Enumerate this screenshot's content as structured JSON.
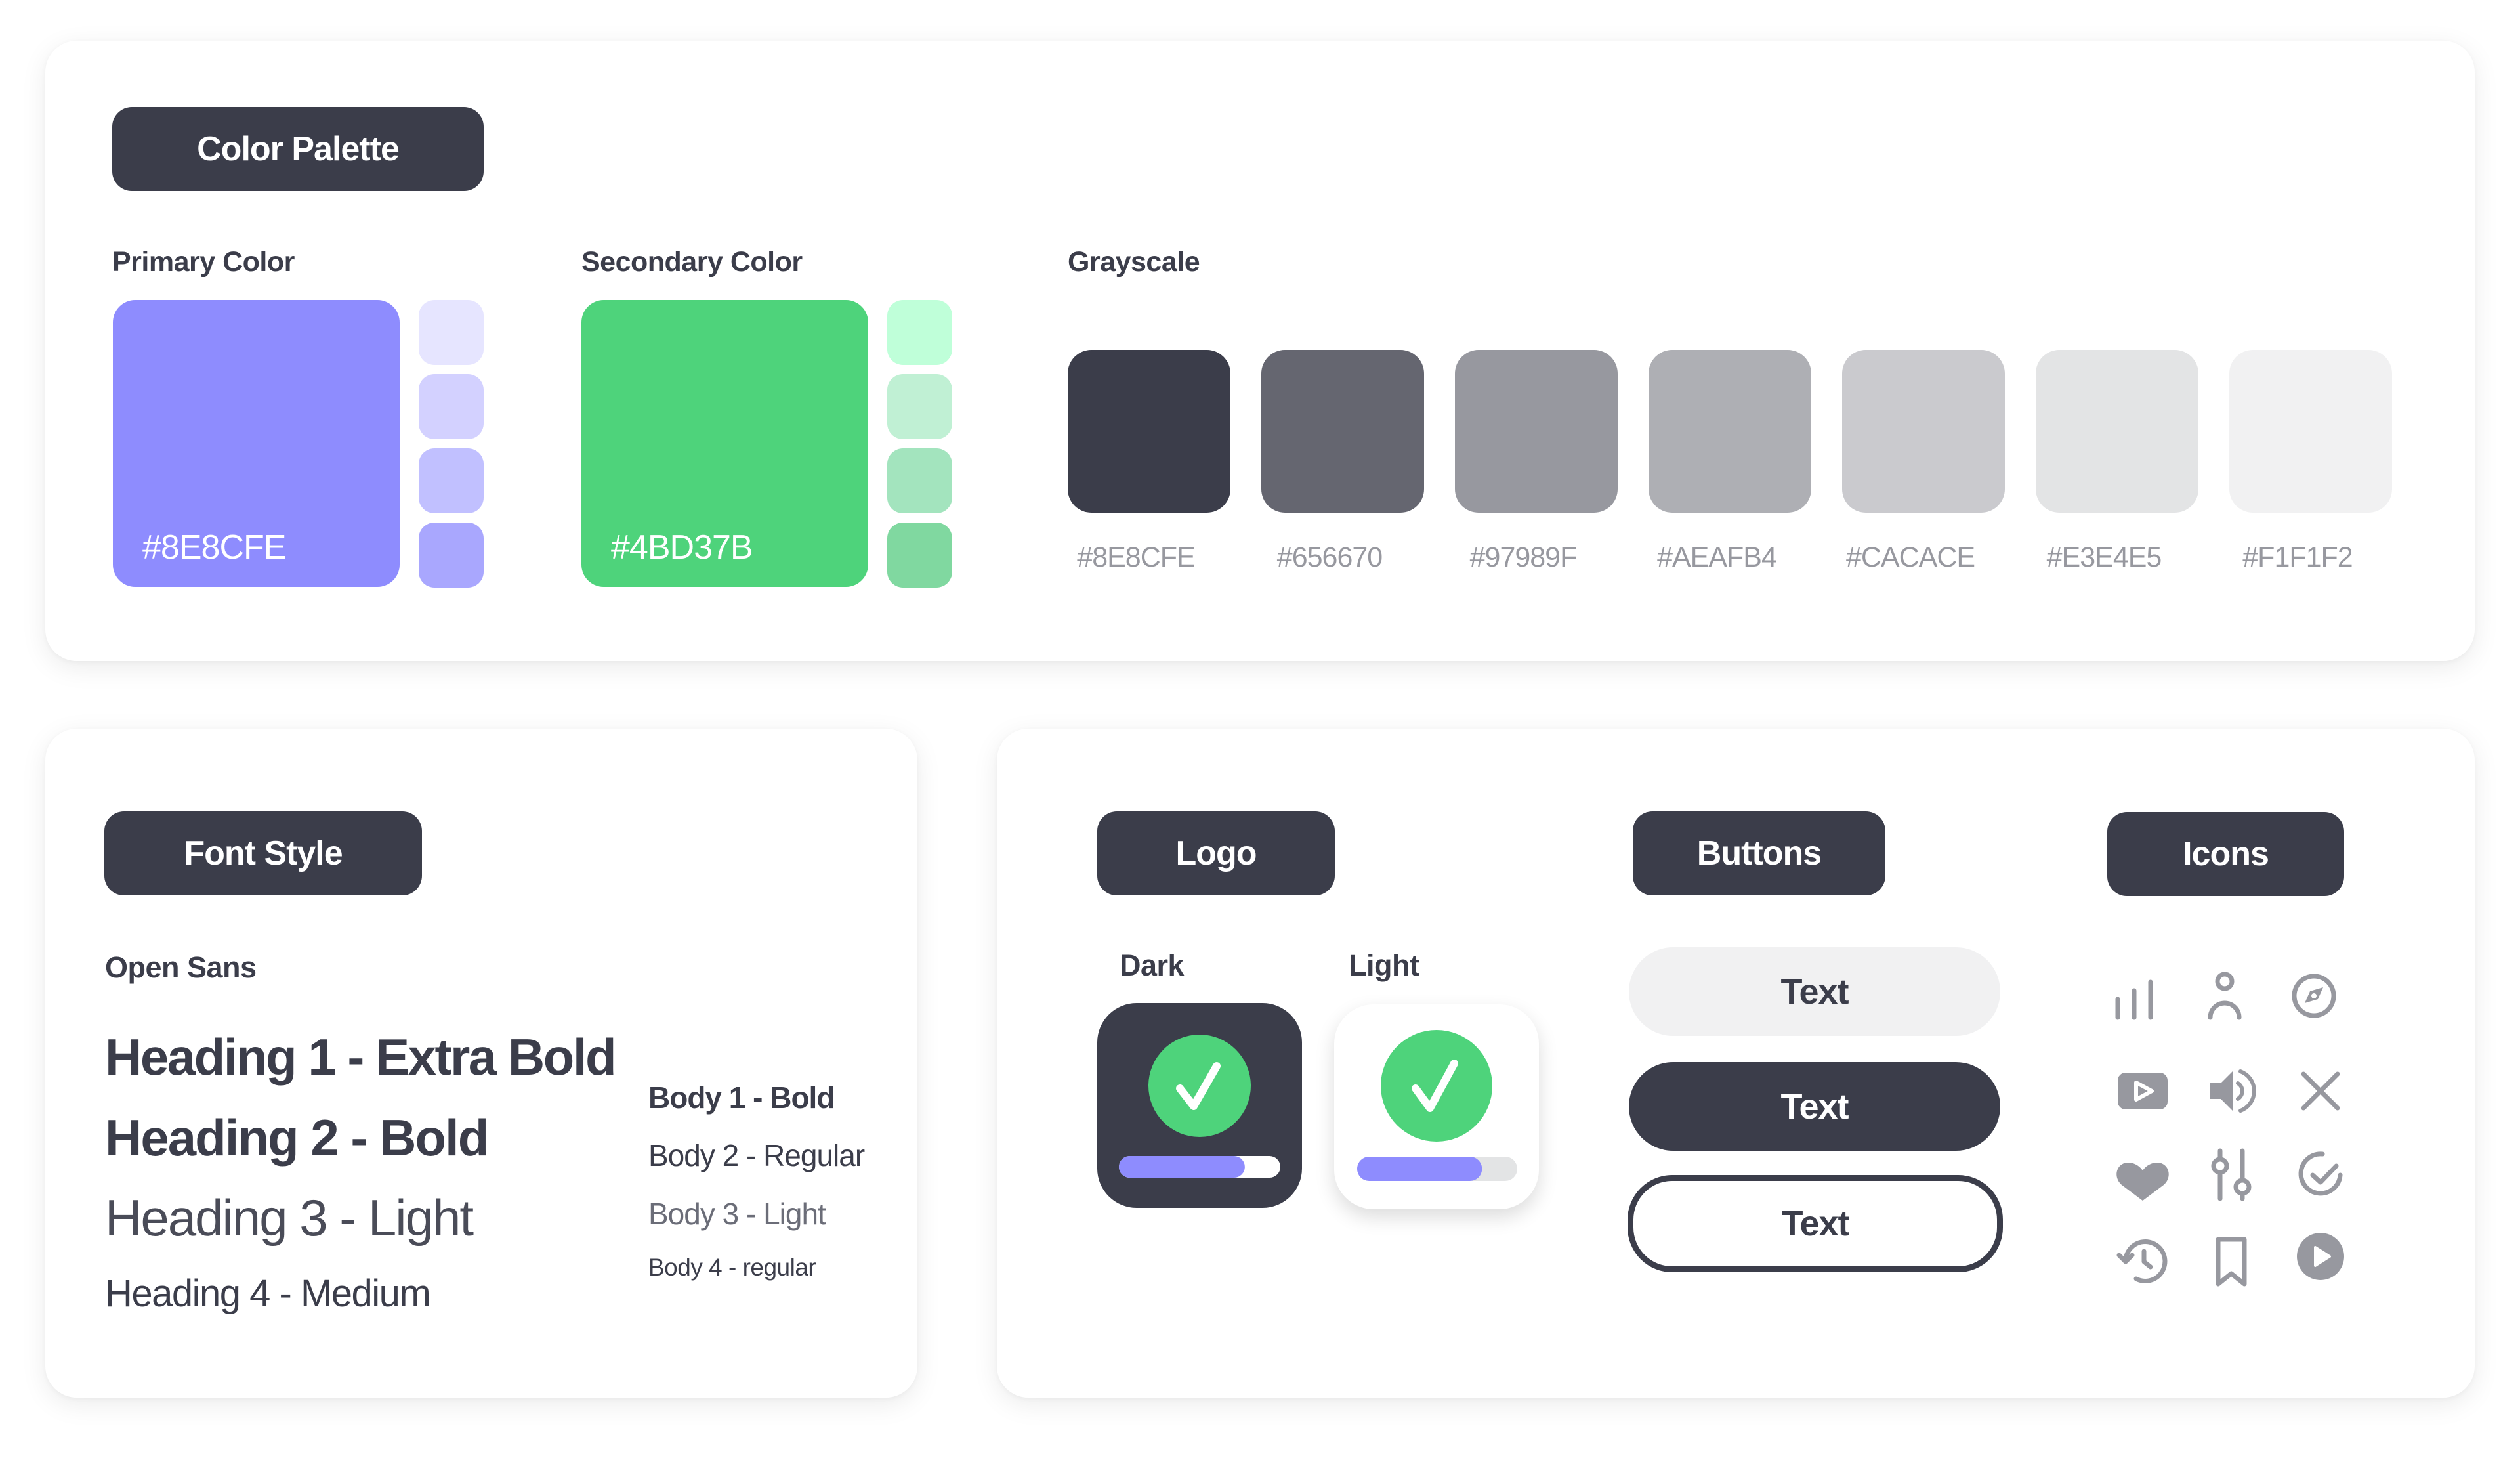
{
  "palette": {
    "title": "Color Palette",
    "primary": {
      "label": "Primary Color",
      "hex": "#8E8CFE",
      "main_color": "#8E8CFE",
      "tints": [
        "#E6E5FF",
        "#D3D1FF",
        "#C1C0FF",
        "#A9A7FE"
      ]
    },
    "secondary": {
      "label": "Secondary Color",
      "hex": "#4BD37B",
      "main_color": "#4ED37B",
      "tints": [
        "#BFFFD9",
        "#C0F0D4",
        "#A3E4BE",
        "#80D8A0"
      ]
    },
    "grayscale": {
      "label": "Grayscale",
      "swatches": [
        {
          "color": "#3B3D4A",
          "label": "#8E8CFE"
        },
        {
          "color": "#656670",
          "label": "#656670"
        },
        {
          "color": "#97989F",
          "label": "#97989F"
        },
        {
          "color": "#AEAFB4",
          "label": "#AEAFB4"
        },
        {
          "color": "#CACACE",
          "label": "#CACACE"
        },
        {
          "color": "#E3E4E5",
          "label": "#E3E4E5"
        },
        {
          "color": "#F1F1F2",
          "label": "#F1F1F2"
        }
      ]
    }
  },
  "fonts": {
    "title": "Font Style",
    "family": "Open Sans",
    "headings": [
      "Heading 1 - Extra Bold",
      "Heading 2 - Bold",
      "Heading 3 - Light",
      "Heading 4 - Medium"
    ],
    "body": [
      "Body 1 - Bold",
      "Body 2 - Regular",
      "Body 3 - Light",
      "Body 4 - regular"
    ]
  },
  "logo": {
    "title": "Logo",
    "dark_label": "Dark",
    "light_label": "Light",
    "progress": 0.78
  },
  "buttons": {
    "title": "Buttons",
    "items": [
      "Text",
      "Text",
      "Text"
    ]
  },
  "icons": {
    "title": "Icons",
    "color": "#97989F",
    "items": [
      "bar-chart-icon",
      "user-icon",
      "compass-icon",
      "video-play-icon",
      "volume-icon",
      "close-icon",
      "heart-icon",
      "sliders-icon",
      "check-circle-icon",
      "history-icon",
      "bookmark-icon",
      "play-circle-icon"
    ]
  },
  "colors": {
    "dark": "#3B3D4A",
    "accent": "#8E8CFE",
    "success": "#4ED37B"
  }
}
